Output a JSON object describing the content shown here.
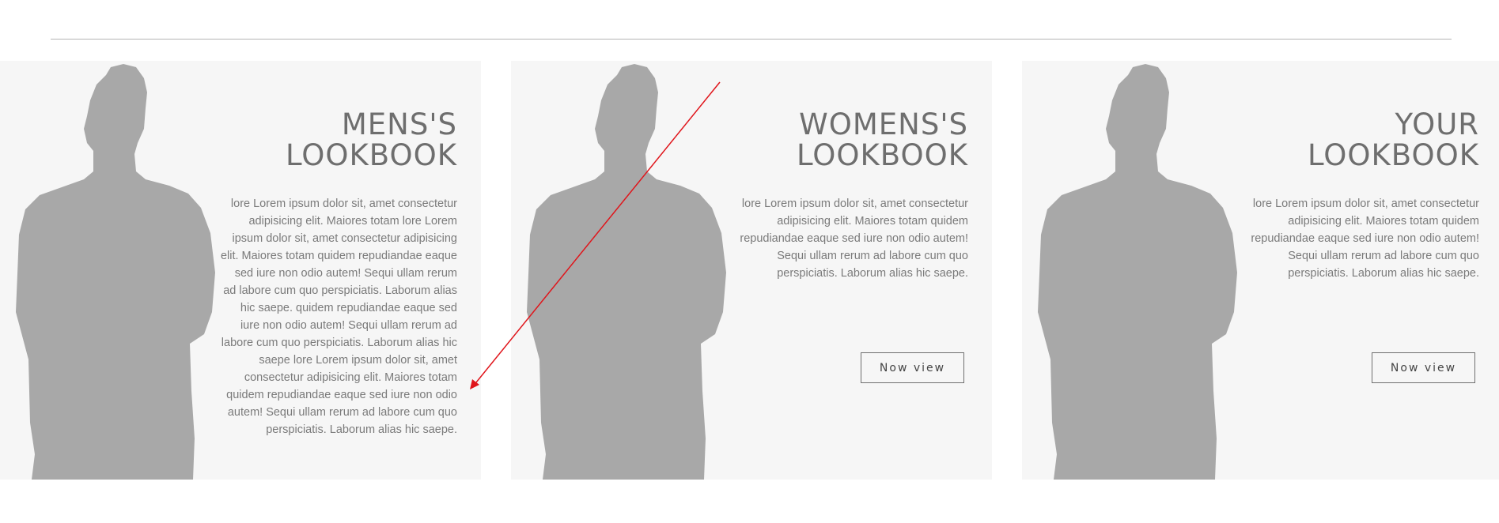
{
  "cards": [
    {
      "title_line1": "MENS'S",
      "title_line2": "LOOKBOOK",
      "body": "lore Lorem ipsum dolor sit, amet consectetur adipisicing elit. Maiores totam lore Lorem ipsum dolor sit, amet consectetur adipisicing elit. Maiores totam quidem repudiandae eaque sed iure non odio autem! Sequi ullam rerum ad labore cum quo perspiciatis. Laborum alias hic saepe. quidem repudiandae eaque sed iure non odio autem! Sequi ullam rerum ad labore cum quo perspiciatis. Laborum alias hic saepe lore Lorem ipsum dolor sit, amet consectetur adipisicing elit. Maiores totam quidem repudiandae eaque sed iure non odio autem! Sequi ullam rerum ad labore cum quo perspiciatis. Laborum alias hic saepe."
    },
    {
      "title_line1": "WOMENS'S",
      "title_line2": "LOOKBOOK",
      "body": "lore Lorem ipsum dolor sit, amet consectetur adipisicing elit. Maiores totam quidem repudiandae eaque sed iure non odio autem! Sequi ullam rerum ad labore cum quo perspiciatis. Laborum alias hic saepe.",
      "button_label": "Now view"
    },
    {
      "title_line1": "YOUR",
      "title_line2": "LOOKBOOK",
      "body": "lore Lorem ipsum dolor sit, amet consectetur adipisicing elit. Maiores totam quidem repudiandae eaque sed iure non odio autem! Sequi ullam rerum ad labore cum quo perspiciatis. Laborum alias hic saepe.",
      "button_label": "Now view"
    }
  ],
  "colors": {
    "card_background": "#f6f6f6",
    "silhouette": "#a8a8a8",
    "title_text": "#6e6e6e",
    "body_text": "#7a7a7a",
    "annotation_arrow": "#e0151b"
  },
  "icons": {
    "card_image": "person-silhouette-icon",
    "annotation": "red-arrow-annotation"
  }
}
